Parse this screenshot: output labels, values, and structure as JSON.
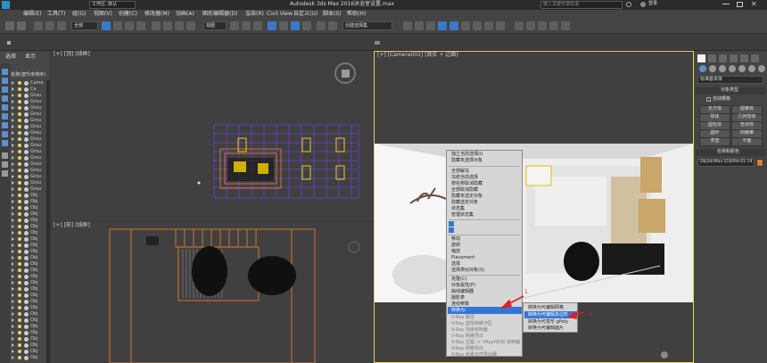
{
  "title_bar": {
    "app_title": "Autodesk 3ds Max 2016",
    "file_name": "沐浴室设置.max",
    "workspace": "工作区: 默认",
    "search_placeholder": "键入关键字或短语",
    "login": "登录"
  },
  "menu": [
    "编辑(E)",
    "工具(T)",
    "组(G)",
    "视图(V)",
    "创建(C)",
    "修改器(M)",
    "动画(A)",
    "图形编辑器(D)",
    "渲染(R)",
    "Civil View",
    "自定义(U)",
    "脚本(S)",
    "帮助(H)"
  ],
  "toolbar": {
    "selection_filter": "全部",
    "view_dropdown": "视图",
    "selection_set": "创建选择集"
  },
  "left_panel": {
    "tabs": [
      "选择",
      "显示"
    ],
    "header": "名称(按升序排序)",
    "rows": [
      "Came",
      "Ca",
      "Grou",
      "Grou",
      "Grou",
      "Grou",
      "Grou",
      "Grou",
      "Grou",
      "Grou",
      "Grou",
      "Grou",
      "Grou",
      "Grou",
      "Grou",
      "Grou",
      "Grou",
      "Grou",
      "Obj",
      "Obj",
      "Obj",
      "Obj",
      "Obj",
      "Obj",
      "Obj",
      "Obj",
      "Obj",
      "Obj",
      "Obj",
      "Obj",
      "Obj",
      "Obj",
      "Obj",
      "Obj",
      "Obj",
      "Obj",
      "Obj",
      "Obj",
      "Obj",
      "Obj",
      "Obj",
      "Obj",
      "Obj",
      "Obj",
      "Obj"
    ]
  },
  "viewports": {
    "top": "[+] [顶] [线框]",
    "front": "[+] [前] [线框]",
    "camera": "[+] [Camera001] [真实 + 边面]"
  },
  "context_menu": {
    "items": [
      "独立当前选择(I)",
      "隐藏未选择对象",
      "",
      "全部解冻",
      "冻结当前选择",
      "按名称取消隐藏",
      "全部取消隐藏",
      "隐藏未选定对象",
      "隐藏选定对象",
      "状态集",
      "管理状态集",
      "",
      "",
      "",
      "移动",
      "旋转",
      "缩放",
      "Placement",
      "选择",
      "选择类似对象(S)",
      "",
      "克隆(C)",
      "对象属性(P)",
      "曲线编辑器",
      "摄影表",
      "连线参数",
      "转换为:",
      "V-Ray 属性",
      "V-Ray 虚拟帧缓冲区",
      "V-Ray 场景转换器",
      "V-Ray 网格导出",
      "V-Ray 位图 -> VRayHDRI 转换器",
      "V-Ray 网格导出",
      "V-Ray 场景文件导出器"
    ],
    "highlighted": "转换为:"
  },
  "submenu": {
    "items": [
      "转换为可编辑网格",
      "转换为可编辑多边形",
      "转换为可变形 gPoly",
      "转换为可编辑面片"
    ],
    "highlighted": "转换为可编辑多边形"
  },
  "annotations": {
    "marker_1": "1",
    "marker_2": "2"
  },
  "right_panel": {
    "dropdown": "标准基本体",
    "section_object_type": "对象类型",
    "autogrid": "自动栅格",
    "buttons": [
      "长方体",
      "圆锥体",
      "球体",
      "几何球体",
      "圆柱体",
      "管状体",
      "圆环",
      "四棱锥",
      "茶壶",
      "平面"
    ],
    "section_name_color": "名称和颜色",
    "object_name": "Obj3dsMax-31849a-01-19"
  },
  "colors": {
    "accent_blue": "#3c78c8",
    "highlight": "#3375d6",
    "grid_purple": "#6a3fd0",
    "wire_orange": "#e07a2a",
    "annotation_red": "#e02020",
    "selection_yellow": "#f0d000"
  }
}
